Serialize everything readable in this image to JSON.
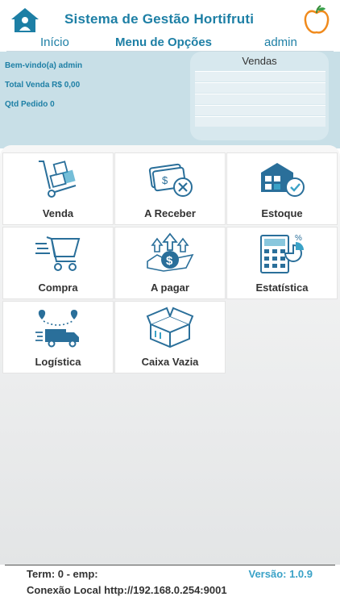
{
  "header": {
    "title": "Sistema de Gestão Hortifruti",
    "nav": [
      {
        "label": "Início"
      },
      {
        "label": "Menu de Opções"
      },
      {
        "label": "admin"
      }
    ]
  },
  "info": {
    "welcome": "Bem-vindo(a) admin",
    "total_venda": "Total Venda R$ 0,00",
    "qtd_pedido": "Qtd Pedido 0",
    "vendas_title": "Vendas"
  },
  "menu": [
    {
      "label": "Venda",
      "icon": "hand-truck-icon"
    },
    {
      "label": "A Receber",
      "icon": "money-receive-icon"
    },
    {
      "label": "Estoque",
      "icon": "warehouse-icon"
    },
    {
      "label": "Compra",
      "icon": "shopping-cart-icon"
    },
    {
      "label": "A pagar",
      "icon": "money-pay-icon"
    },
    {
      "label": "Estatística",
      "icon": "calculator-chart-icon"
    },
    {
      "label": "Logística",
      "icon": "delivery-truck-icon"
    },
    {
      "label": "Caixa Vazia",
      "icon": "empty-box-icon"
    }
  ],
  "footer": {
    "term": "Term: 0 - emp:",
    "version": "Versão: 1.0.9",
    "connection": "Conexão Local http://192.168.0.254:9001"
  },
  "colors": {
    "accent": "#1d7fa5",
    "panel": "#c8dfe7",
    "version": "#3aa2c7"
  }
}
